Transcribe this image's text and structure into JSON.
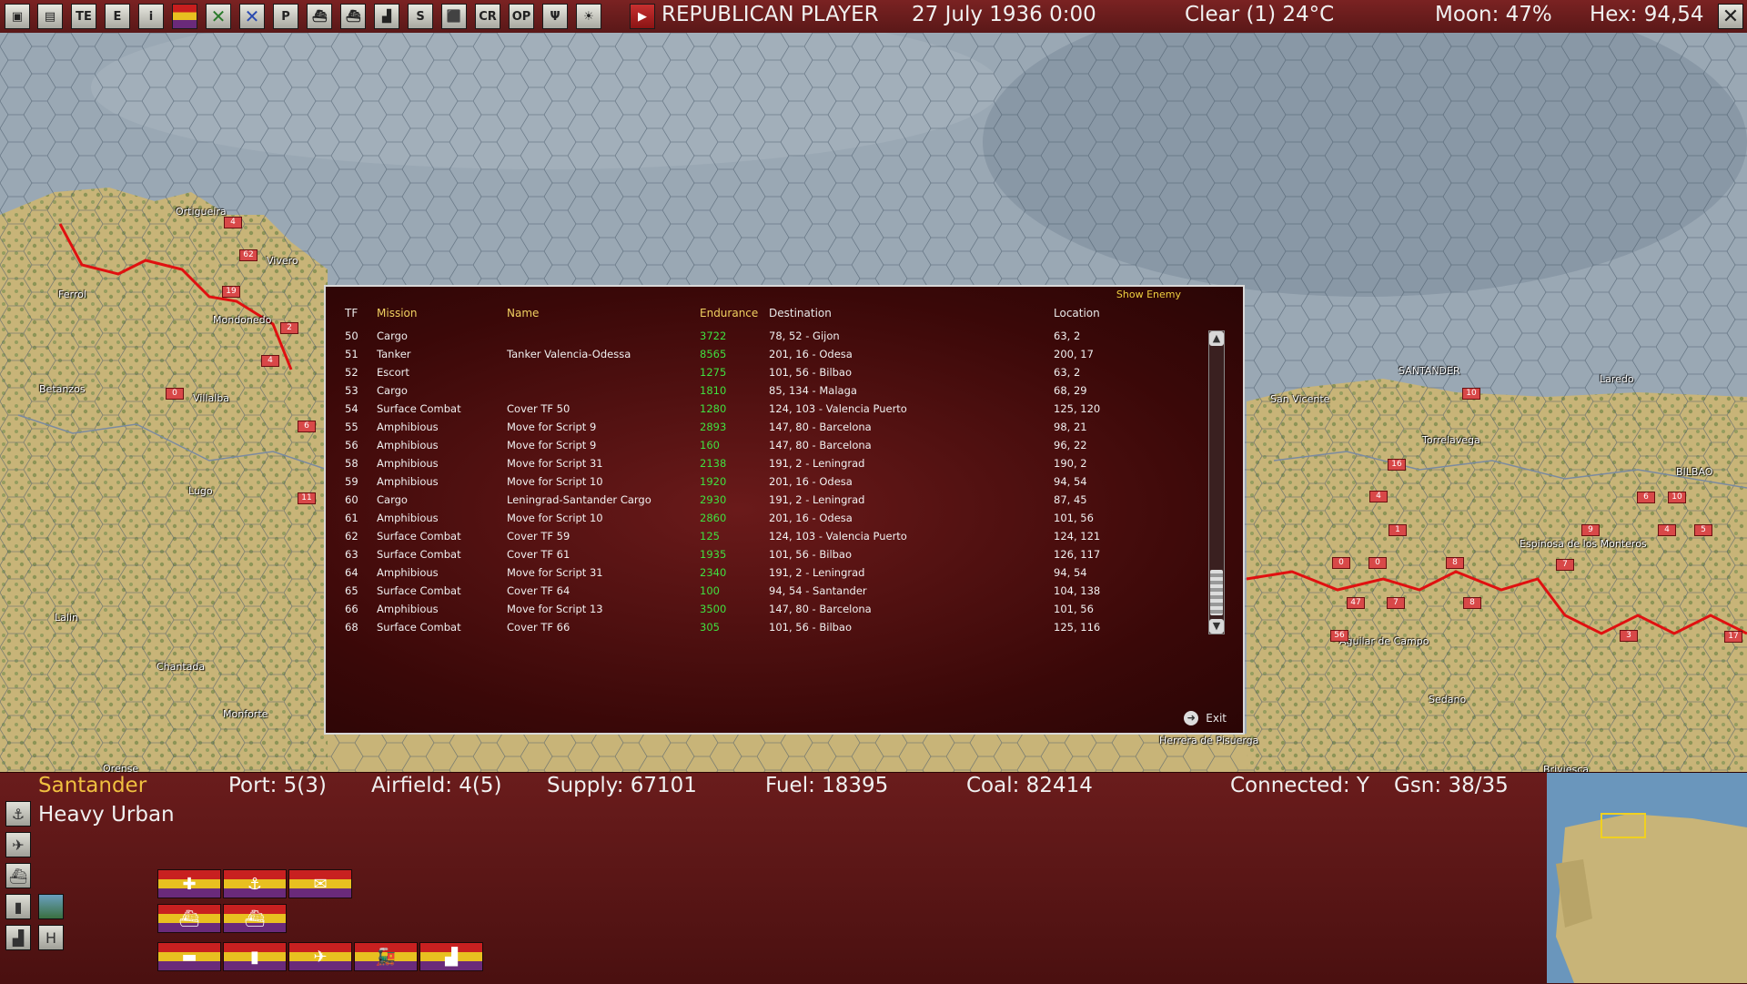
{
  "topbar": {
    "player": "REPUBLICAN PLAYER",
    "date": "27 July 1936 0:00",
    "weather": "Clear (1) 24°C",
    "moon": "Moon: 47%",
    "hex": "Hex: 94,54",
    "buttons": [
      "save-icon",
      "save-as-icon",
      "te-icon",
      "e-icon",
      "info-icon",
      "flag-icon",
      "land-icon",
      "air-icon",
      "flag2-icon",
      "ship-icon",
      "ship2-icon",
      "factory-icon",
      "supply-icon",
      "map-icon",
      "cr-icon",
      "op-icon",
      "antenna-icon",
      "weather-icon"
    ],
    "button_glyphs": [
      "▣",
      "▤",
      "TE",
      "E",
      "i",
      "",
      "✕",
      "✕",
      "P",
      "⛴",
      "⛴",
      "▟",
      "S",
      "⬛",
      "CR",
      "OP",
      "Ψ",
      "☀"
    ]
  },
  "map": {
    "labels": [
      {
        "name": "Ortigueira"
      },
      {
        "name": "Vivero"
      },
      {
        "name": "Ferrol"
      },
      {
        "name": "Mondonedo"
      },
      {
        "name": "Betanzos"
      },
      {
        "name": "Villalba"
      },
      {
        "name": "Lugo"
      },
      {
        "name": "Lalin"
      },
      {
        "name": "Chantada"
      },
      {
        "name": "Monforte"
      },
      {
        "name": "Orense"
      },
      {
        "name": "SANTANDER"
      },
      {
        "name": "San Vicente"
      },
      {
        "name": "Laredo"
      },
      {
        "name": "Torrelavega"
      },
      {
        "name": "BILBAO"
      },
      {
        "name": "Espinosa de los Monteros"
      },
      {
        "name": "Aguilar de Campo"
      },
      {
        "name": "Sedano"
      },
      {
        "name": "Herrera de Pisuerga"
      },
      {
        "name": "Briviesca"
      }
    ],
    "unit_tags": [
      "4",
      "62",
      "19",
      "2",
      "4",
      "0",
      "6",
      "11",
      "16",
      "4",
      "1",
      "0",
      "0",
      "8",
      "7",
      "47",
      "7",
      "8",
      "56",
      "10",
      "6",
      "10",
      "4",
      "5",
      "9",
      "3",
      "17"
    ]
  },
  "dialog": {
    "show_enemy": "Show Enemy",
    "headers": {
      "tf": "TF",
      "mission": "Mission",
      "name": "Name",
      "endurance": "Endurance",
      "destination": "Destination",
      "location": "Location"
    },
    "rows": [
      {
        "tf": "50",
        "mission": "Cargo",
        "name": "",
        "endurance": "3722",
        "destination": "78, 52 - Gijon",
        "location": "63, 2"
      },
      {
        "tf": "51",
        "mission": "Tanker",
        "name": "Tanker Valencia-Odessa",
        "endurance": "8565",
        "destination": "201, 16 - Odesa",
        "location": "200, 17"
      },
      {
        "tf": "52",
        "mission": "Escort",
        "name": "",
        "endurance": "1275",
        "destination": "101, 56 - Bilbao",
        "location": "63, 2"
      },
      {
        "tf": "53",
        "mission": "Cargo",
        "name": "",
        "endurance": "1810",
        "destination": "85, 134 - Malaga",
        "location": "68, 29"
      },
      {
        "tf": "54",
        "mission": "Surface Combat",
        "name": "Cover TF 50",
        "endurance": "1280",
        "destination": "124, 103 - Valencia Puerto",
        "location": "125, 120"
      },
      {
        "tf": "55",
        "mission": "Amphibious",
        "name": "Move for Script 9",
        "endurance": "2893",
        "destination": "147, 80 - Barcelona",
        "location": "98, 21"
      },
      {
        "tf": "56",
        "mission": "Amphibious",
        "name": "Move for Script 9",
        "endurance": "160",
        "destination": "147, 80 - Barcelona",
        "location": "96, 22"
      },
      {
        "tf": "58",
        "mission": "Amphibious",
        "name": "Move for Script 31",
        "endurance": "2138",
        "destination": "191, 2 - Leningrad",
        "location": "190, 2"
      },
      {
        "tf": "59",
        "mission": "Amphibious",
        "name": "Move for Script 10",
        "endurance": "1920",
        "destination": "201, 16 - Odesa",
        "location": "94, 54"
      },
      {
        "tf": "60",
        "mission": "Cargo",
        "name": "Leningrad-Santander Cargo",
        "endurance": "2930",
        "destination": "191, 2 - Leningrad",
        "location": "87, 45"
      },
      {
        "tf": "61",
        "mission": "Amphibious",
        "name": "Move for Script 10",
        "endurance": "2860",
        "destination": "201, 16 - Odesa",
        "location": "101, 56"
      },
      {
        "tf": "62",
        "mission": "Surface Combat",
        "name": "Cover TF 59",
        "endurance": "125",
        "destination": "124, 103 - Valencia Puerto",
        "location": "124, 121"
      },
      {
        "tf": "63",
        "mission": "Surface Combat",
        "name": "Cover TF 61",
        "endurance": "1935",
        "destination": "101, 56 - Bilbao",
        "location": "126, 117"
      },
      {
        "tf": "64",
        "mission": "Amphibious",
        "name": "Move for Script 31",
        "endurance": "2340",
        "destination": "191, 2 - Leningrad",
        "location": "94, 54"
      },
      {
        "tf": "65",
        "mission": "Surface Combat",
        "name": "Cover TF 64",
        "endurance": "100",
        "destination": "94, 54 - Santander",
        "location": "104, 138"
      },
      {
        "tf": "66",
        "mission": "Amphibious",
        "name": "Move for Script 13",
        "endurance": "3500",
        "destination": "147, 80 - Barcelona",
        "location": "101, 56"
      },
      {
        "tf": "68",
        "mission": "Surface Combat",
        "name": "Cover TF 66",
        "endurance": "305",
        "destination": "101, 56 - Bilbao",
        "location": "125, 116"
      }
    ],
    "exit_label": "Exit"
  },
  "bottom": {
    "location": "Santander",
    "terrain": "Heavy Urban",
    "port": "Port: 5(3)",
    "airfield": "Airfield: 4(5)",
    "supply": "Supply: 67101",
    "fuel": "Fuel: 18395",
    "coal": "Coal: 82414",
    "connected": "Connected: Y",
    "gsn": "Gsn: 38/35",
    "side_buttons": [
      "anchor-icon",
      "plane-icon",
      "ship-icon",
      "flag-icon",
      "hq-icon"
    ],
    "side_glyphs": [
      "⚓",
      "✈",
      "⛴",
      "▮",
      "▟"
    ],
    "h_label": "H"
  }
}
